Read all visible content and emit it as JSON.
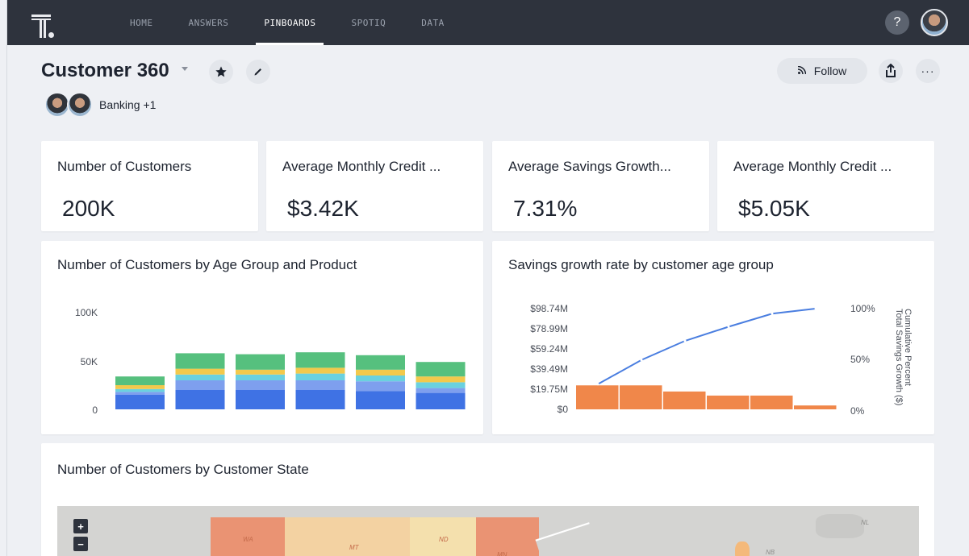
{
  "nav": {
    "items": [
      {
        "label": "HOME",
        "active": false
      },
      {
        "label": "ANSWERS",
        "active": false
      },
      {
        "label": "PINBOARDS",
        "active": true
      },
      {
        "label": "SPOTIQ",
        "active": false
      },
      {
        "label": "DATA",
        "active": false
      }
    ],
    "help_label": "?"
  },
  "header": {
    "title": "Customer 360",
    "tags": "Banking +1",
    "follow_label": "Follow",
    "more_label": "···"
  },
  "kpis": [
    {
      "title": "Number of Customers",
      "value": "200K"
    },
    {
      "title": "Average Monthly Credit ...",
      "value": "$3.42K"
    },
    {
      "title": "Average Savings Growth...",
      "value": "7.31%"
    },
    {
      "title": "Average Monthly Credit ...",
      "value": "$5.05K"
    }
  ],
  "chart_data": [
    {
      "type": "bar",
      "title": "Number of Customers by Age Group and Product",
      "y_ticks": [
        "100K",
        "50K",
        "0"
      ],
      "ylim": [
        0,
        100000
      ],
      "stacked": true,
      "colors": [
        "#3f72e4",
        "#7e9fee",
        "#6ad1df",
        "#f2c94c",
        "#56c07e"
      ],
      "series": [
        {
          "values": [
            15000,
            20000,
            20000,
            20000,
            19000,
            17000
          ]
        },
        {
          "values": [
            3000,
            10000,
            10000,
            10000,
            10000,
            5000
          ]
        },
        {
          "values": [
            3000,
            6000,
            6000,
            7000,
            6000,
            6000
          ]
        },
        {
          "values": [
            4000,
            6000,
            5000,
            6000,
            6000,
            6000
          ]
        },
        {
          "values": [
            9000,
            16000,
            16000,
            16000,
            15000,
            15000
          ]
        }
      ]
    },
    {
      "type": "bar",
      "title": "Savings growth rate by customer age group",
      "y_ticks": [
        "$98.74M",
        "$78.99M",
        "$59.24M",
        "$39.49M",
        "$19.75M",
        "$0"
      ],
      "y2_ticks": [
        "100%",
        "50%",
        "0%"
      ],
      "y2_label": "Cumulative Percent Total Savings Growth ($)",
      "ylim": [
        0,
        98.74
      ],
      "bar_color": "#f0874a",
      "line_color": "#4a7ee0",
      "values": [
        23.5,
        23.5,
        17.5,
        13.5,
        13.5,
        3.8
      ],
      "cumulative_percent": [
        25,
        49,
        68,
        82,
        95,
        100
      ]
    }
  ],
  "state_chart": {
    "title": "Number of Customers by Customer State",
    "zoom_in_label": "+",
    "zoom_out_label": "−",
    "regions": [
      {
        "label": "WA",
        "color": "#ea9373"
      },
      {
        "label": "MT",
        "color": "#f3d2a2"
      },
      {
        "label": "ND",
        "color": "#f4e0ad"
      },
      {
        "label": "MN",
        "color": "#ea9373"
      },
      {
        "label": "NB",
        "color": "#f4b97a"
      },
      {
        "label": "NL",
        "color": "#c9c9c7"
      }
    ]
  }
}
